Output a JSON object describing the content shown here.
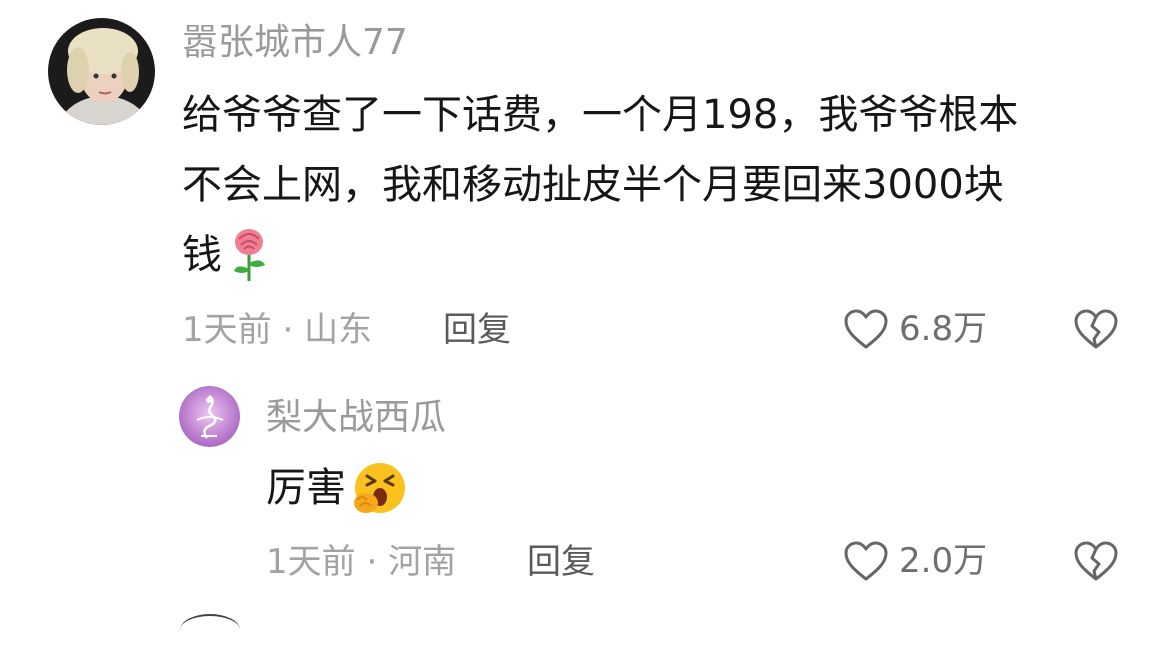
{
  "comments": [
    {
      "username": "嚣张城市人77",
      "avatar_icon": "user-avatar-photo",
      "text_lines": [
        "给爷爷查了一下话费，一个月198，我爷爷根本",
        "不会上网，我和移动扯皮半个月要回来3000块",
        "钱"
      ],
      "emoji_icon": "rose-emoji",
      "time": "1天前",
      "location": "山东",
      "reply_label": "回复",
      "like_count": "6.8万"
    },
    {
      "username": "梨大战西瓜",
      "avatar_icon": "user-avatar-illustration",
      "text": "厉害",
      "emoji_icon": "face-with-hand-over-mouth-emoji",
      "time": "1天前",
      "location": "河南",
      "reply_label": "回复",
      "like_count": "2.0万"
    }
  ],
  "colors": {
    "muted": "#a3a3a3",
    "text": "#161616",
    "icon": "#666666"
  }
}
